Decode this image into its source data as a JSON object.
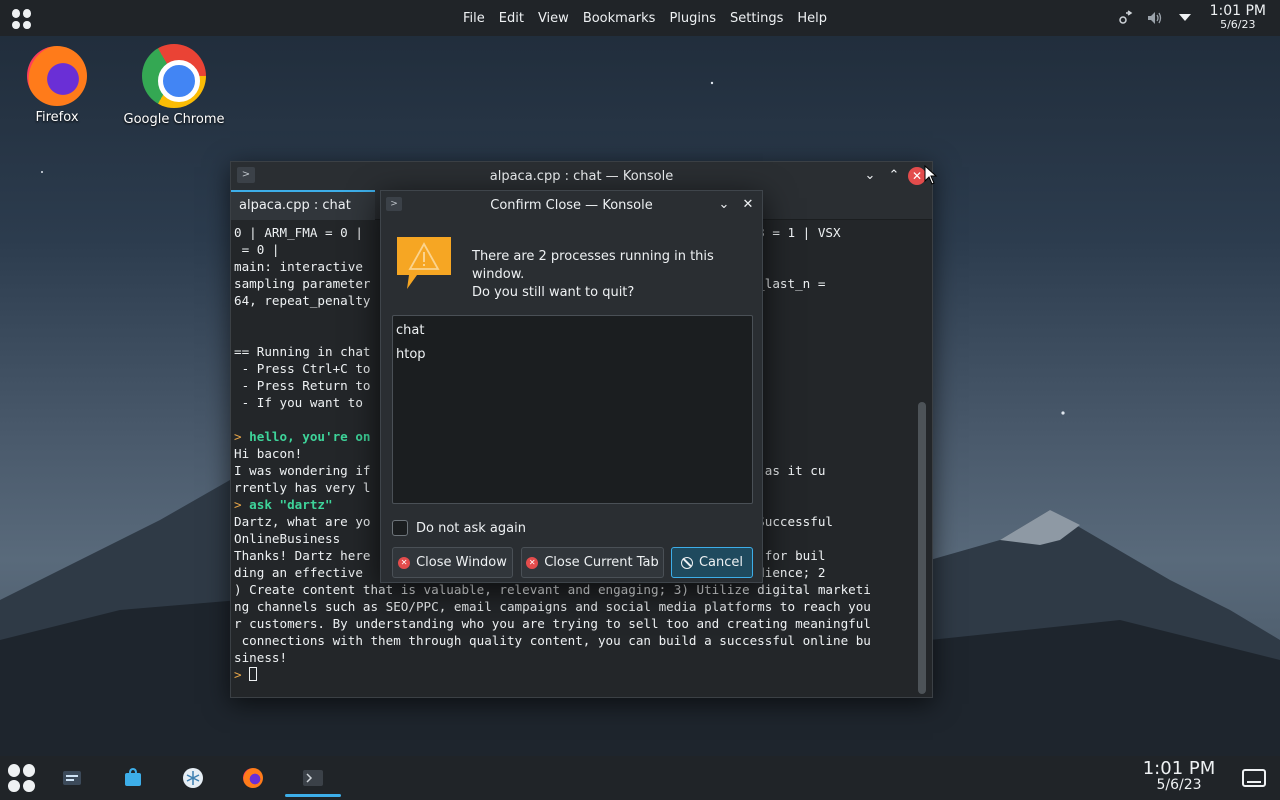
{
  "colors": {
    "accent": "#3daee9",
    "danger": "#e34c4c",
    "panel": "#202428",
    "window": "#2a2e32"
  },
  "top_panel": {
    "menu": [
      "File",
      "Edit",
      "View",
      "Bookmarks",
      "Plugins",
      "Settings",
      "Help"
    ],
    "tray_icons": [
      "network-icon",
      "volume-icon",
      "expand-tray-icon"
    ],
    "clock": {
      "time": "1:01 PM",
      "date": "5/6/23"
    }
  },
  "desktop": {
    "icons": [
      {
        "label": "Firefox",
        "icon": "firefox-icon"
      },
      {
        "label": "Google Chrome",
        "icon": "chrome-icon"
      }
    ]
  },
  "konsole": {
    "title": "alpaca.cpp : chat — Konsole",
    "tab_label": "alpaca.cpp : chat",
    "terminal_lines": [
      "0 | ARM_FMA = 0 |                                             0 | SSE3 = 1 | VSX",
      " = 0 |",
      "main: interactive",
      "sampling parameter                                           , repeat_last_n =",
      "64, repeat_penalty",
      "",
      "",
      "== Running in chat",
      " - Press Ctrl+C to",
      " - Press Return to",
      " - If you want to",
      "",
      "> hello, you're on",
      "Hi bacon!",
      "I was wondering if                                          n this VM as it cu",
      "rrently has very l",
      "> ask \"dartz\"",
      "Dartz, what are yo                                          siness? #Successful",
      "OnlineBusiness",
      "Thanks! Dartz here                                          hree tips for buil",
      "ding an effective                                           target audience; 2",
      ") Create content that is valuable, relevant and engaging; 3) Utilize digital marketi",
      "ng channels such as SEO/PPC, email campaigns and social media platforms to reach you",
      "r customers. By understanding who you are trying to sell too and creating meaningful",
      " connections with them through quality content, you can build a successful online bu",
      "siness!",
      "> "
    ]
  },
  "dialog": {
    "title": "Confirm Close — Konsole",
    "message_line1": "There are 2 processes running in this window.",
    "message_line2": "Do you still want to quit?",
    "processes": [
      "chat",
      "htop"
    ],
    "checkbox_label": "Do not ask again",
    "checkbox_checked": false,
    "buttons": {
      "close_window": "Close Window",
      "close_tab": "Close Current Tab",
      "cancel": "Cancel"
    }
  },
  "taskbar": {
    "tasks": [
      "system-settings-icon",
      "discover-store-icon",
      "kde-connect-icon",
      "firefox-icon",
      "konsole-icon"
    ],
    "clock": {
      "time": "1:01 PM",
      "date": "5/6/23"
    }
  }
}
